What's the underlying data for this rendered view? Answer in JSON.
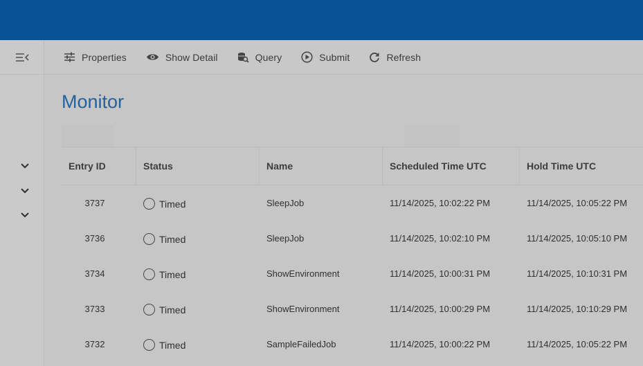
{
  "toolbar": {
    "properties": {
      "label": "Properties",
      "icon": "tune-icon"
    },
    "show_detail": {
      "label": "Show Detail",
      "icon": "eye-icon"
    },
    "query": {
      "label": "Query",
      "icon": "database-search-icon"
    },
    "submit": {
      "label": "Submit",
      "icon": "play-circle-icon"
    },
    "refresh": {
      "label": "Refresh",
      "icon": "refresh-icon"
    }
  },
  "rail": {
    "collapse_icon": "menu-collapse-icon",
    "expanders": [
      "chevron-down-icon",
      "chevron-down-icon",
      "chevron-down-icon"
    ]
  },
  "page": {
    "title": "Monitor"
  },
  "table": {
    "columns": [
      "Entry ID",
      "Status",
      "Name",
      "Scheduled Time UTC",
      "Hold Time UTC"
    ],
    "rows": [
      {
        "id": "3737",
        "status": "Timed",
        "name": "SleepJob",
        "scheduled": "11/14/2025, 10:02:22 PM",
        "hold": "11/14/2025, 10:05:22 PM"
      },
      {
        "id": "3736",
        "status": "Timed",
        "name": "SleepJob",
        "scheduled": "11/14/2025, 10:02:10 PM",
        "hold": "11/14/2025, 10:05:10 PM"
      },
      {
        "id": "3734",
        "status": "Timed",
        "name": "ShowEnvironment",
        "scheduled": "11/14/2025, 10:00:31 PM",
        "hold": "11/14/2025, 10:10:31 PM"
      },
      {
        "id": "3733",
        "status": "Timed",
        "name": "ShowEnvironment",
        "scheduled": "11/14/2025, 10:00:29 PM",
        "hold": "11/14/2025, 10:10:29 PM"
      },
      {
        "id": "3732",
        "status": "Timed",
        "name": "SampleFailedJob",
        "scheduled": "11/14/2025, 10:00:22 PM",
        "hold": "11/14/2025, 10:05:22 PM"
      }
    ]
  },
  "colors": {
    "topbar": "#0a5296",
    "title": "#25619e",
    "overlay_bg": "#c9c9c9"
  }
}
